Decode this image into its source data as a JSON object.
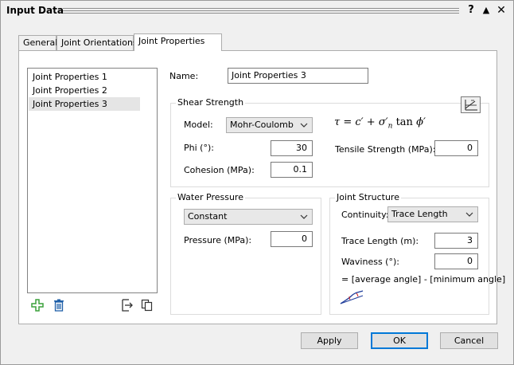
{
  "window": {
    "title": "Input Data",
    "help_label": "?",
    "maximize_label": "▲",
    "close_label": "✕"
  },
  "tabs": [
    {
      "label": "General"
    },
    {
      "label": "Joint Orientations"
    },
    {
      "label": "Joint Properties"
    }
  ],
  "joint_list": {
    "items": [
      "Joint Properties 1",
      "Joint Properties 2",
      "Joint Properties 3"
    ],
    "selected_index": 2
  },
  "name": {
    "label": "Name:",
    "value": "Joint Properties 3"
  },
  "shear_strength": {
    "title": "Shear Strength",
    "model_label": "Model:",
    "model_value": "Mohr-Coulomb",
    "phi_label": "Phi (°):",
    "phi_value": "30",
    "cohesion_label": "Cohesion (MPa):",
    "cohesion_value": "0.1",
    "tensile_label": "Tensile Strength (MPa):",
    "tensile_value": "0",
    "formula_lhs": "τ",
    "formula_eq": "=",
    "formula_c": "c′",
    "formula_plus": "+",
    "formula_sigma": "σ′",
    "formula_sub": "n",
    "formula_tan": "tan",
    "formula_phi": "ϕ′"
  },
  "water_pressure": {
    "title": "Water Pressure",
    "type_value": "Constant",
    "pressure_label": "Pressure (MPa):",
    "pressure_value": "0"
  },
  "joint_structure": {
    "title": "Joint Structure",
    "continuity_label": "Continuity:",
    "continuity_value": "Trace Length",
    "trace_label": "Trace Length (m):",
    "trace_value": "3",
    "waviness_label": "Waviness (°):",
    "waviness_value": "0",
    "note": "= [average angle] - [minimum angle]"
  },
  "buttons": {
    "apply": "Apply",
    "ok": "OK",
    "cancel": "Cancel"
  },
  "colors": {
    "accent": "#0078d7",
    "add_icon": "#3aa13a",
    "delete_icon": "#1e5fa8"
  }
}
